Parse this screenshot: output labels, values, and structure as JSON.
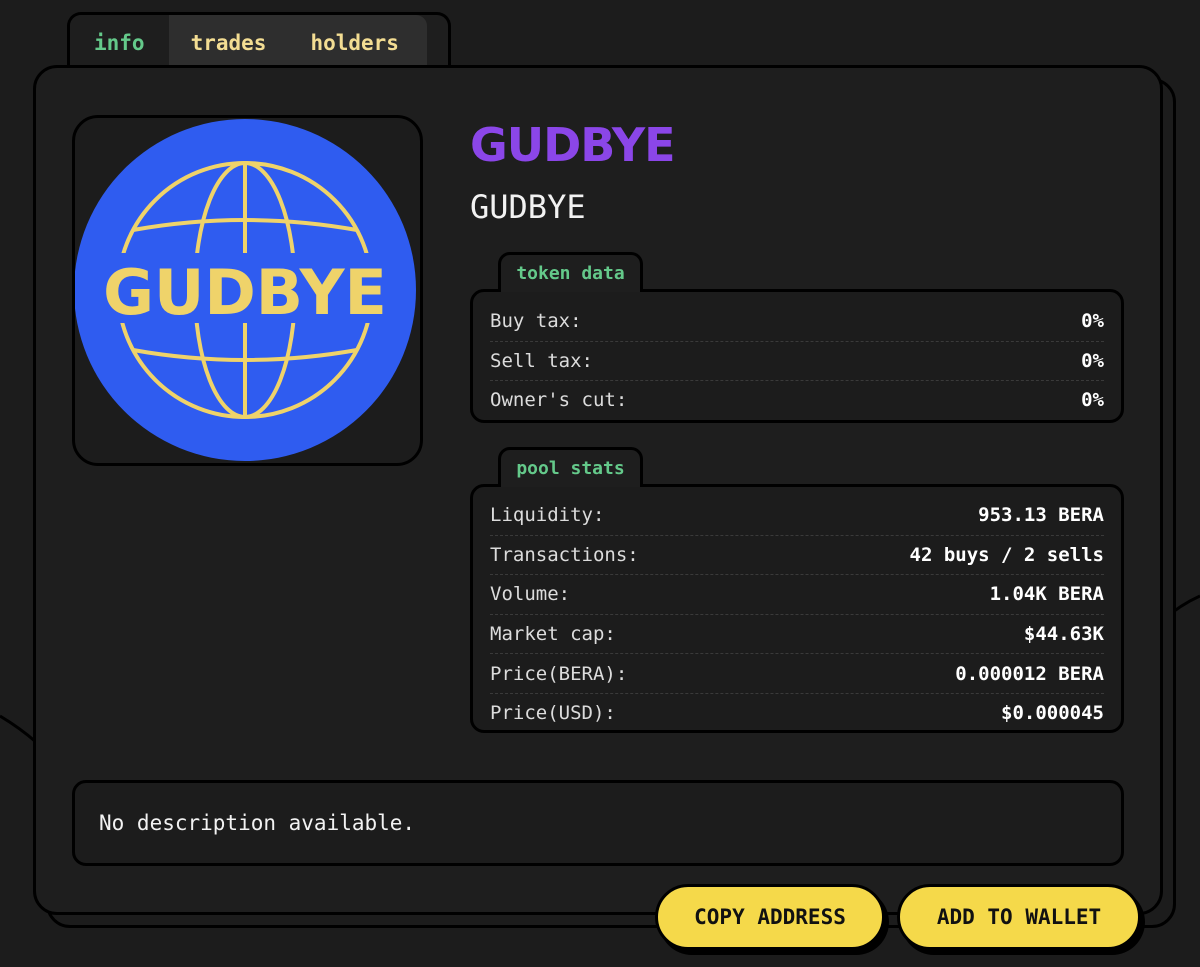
{
  "tabs": [
    {
      "label": "info",
      "active": true
    },
    {
      "label": "trades",
      "active": false
    },
    {
      "label": "holders",
      "active": false
    }
  ],
  "token": {
    "name": "GUDBYE",
    "symbol": "GUDBYE",
    "logo_text": "GUDBYE",
    "logo_colors": {
      "circle": "#2f5cf0",
      "lines": "#efd36a"
    }
  },
  "token_data": {
    "label": "token data",
    "rows": [
      {
        "key": "Buy tax:",
        "value": "0%"
      },
      {
        "key": "Sell tax:",
        "value": "0%"
      },
      {
        "key": "Owner's cut:",
        "value": "0%"
      }
    ]
  },
  "pool_stats": {
    "label": "pool stats",
    "rows": [
      {
        "key": "Liquidity:",
        "value": "953.13 BERA"
      },
      {
        "key": "Transactions:",
        "value": "42 buys / 2 sells"
      },
      {
        "key": "Volume:",
        "value": "1.04K BERA"
      },
      {
        "key": "Market cap:",
        "value": "$44.63K"
      },
      {
        "key": "Price(BERA):",
        "value": "0.000012 BERA"
      },
      {
        "key": "Price(USD):",
        "value": "$0.000045"
      }
    ]
  },
  "description": "No description available.",
  "buttons": {
    "copy_address": "COPY ADDRESS",
    "add_to_wallet": "ADD TO WALLET"
  },
  "colors": {
    "accent_green": "#64c98a",
    "title_purple": "#8b46e8",
    "button_yellow": "#f5d94a",
    "tab_text": "#f3dd93"
  }
}
